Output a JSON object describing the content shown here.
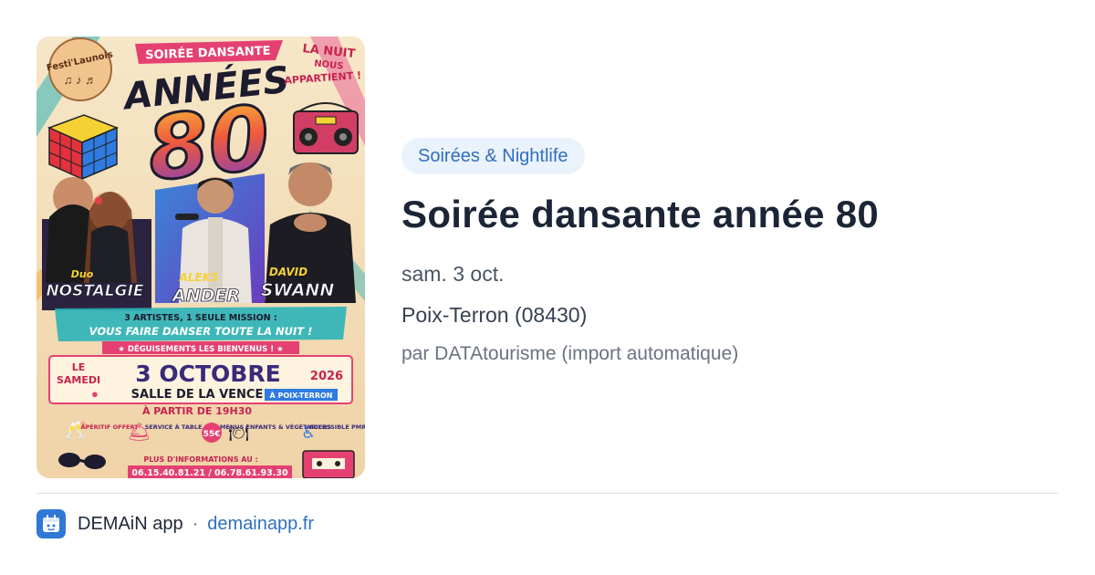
{
  "poster": {
    "alt": "Soirée dansante année 80",
    "festival_logo": "Festi'Launois",
    "header": "SOIRÉE DANSANTE",
    "big_title": "ANNÉES",
    "big_number": "80",
    "tagline_line1": "LA NUIT",
    "tagline_line2": "NOUS",
    "tagline_line3": "APPARTIENT !",
    "artist1_a": "Duo",
    "artist1_b": "NOSTALGIE",
    "artist2_a": "ALEKS",
    "artist2_b": "ANDER",
    "artist3_a": "DAVID",
    "artist3_b": "SWANN",
    "mission_line1": "3 ARTISTES, 1 SEULE MISSION :",
    "mission_line2": "VOUS FAIRE DANSER TOUTE LA NUIT !",
    "costume": "★ DÉGUISEMENTS LES BIENVENUS ! ★",
    "le": "LE",
    "samedi": "SAMEDI",
    "date_big": "3 OCTOBRE",
    "year": "2026",
    "venue": "SALLE DE LA VENCE",
    "town": "À POIX-TERRON",
    "time": "À PARTIR DE 19H30",
    "amen1": "APÉRITIF OFFERT",
    "amen2": "SERVICE À TABLE",
    "price": "55€",
    "amen3": "MENUS ENFANTS & VÉGÉTARIENS",
    "amen4": "ACCESSIBLE PMR",
    "info_label": "PLUS D'INFORMATIONS AU :",
    "phones": "06.15.40.81.21 / 06.78.61.93.30"
  },
  "event": {
    "category": "Soirées & Nightlife",
    "title": "Soirée dansante année 80",
    "date": "sam. 3 oct.",
    "location": "Poix-Terron (08430)",
    "source": "par DATAtourisme (import automatique)"
  },
  "footer": {
    "app_name": "DEMAiN app",
    "separator": "·",
    "domain": "demainapp.fr"
  },
  "colors": {
    "accent": "#2f6fbd",
    "pill_bg": "#eaf2fc",
    "title": "#1b2536",
    "app_icon": "#2f78d6"
  }
}
